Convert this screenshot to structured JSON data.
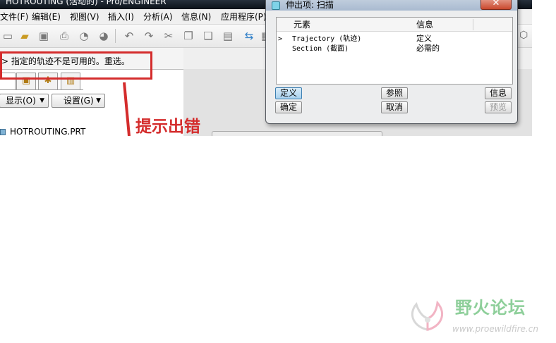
{
  "app": {
    "title": "HOTROUTING (活动的) - Pro/ENGINEER",
    "menu": [
      "文件(F)",
      "编辑(E)",
      "视图(V)",
      "插入(I)",
      "分析(A)",
      "信息(N)",
      "应用程序(P)"
    ],
    "message": "指定的轨迹不是可用的。重选。",
    "panel_dropdowns": [
      "显示(O)",
      "设置(G)"
    ],
    "tree_root": "HOTROUTING.PRT"
  },
  "dialog": {
    "title": "伸出项: 扫描",
    "columns": [
      "元素",
      "信息"
    ],
    "rows": [
      {
        "marker": ">",
        "element": "Trajectory (轨迹)",
        "info": "定义"
      },
      {
        "marker": "",
        "element": "Section (截面)",
        "info": "必需的"
      }
    ],
    "buttons": {
      "define": "定义",
      "reference": "参照",
      "info": "信息",
      "ok": "确定",
      "cancel": "取消",
      "preview": "预览"
    },
    "close_symbol": "✕"
  },
  "annotation": {
    "label": "提示出错",
    "color": "#d42c2c"
  },
  "watermark": {
    "text": "野火论坛",
    "url": "www.proewildfire.cn"
  },
  "colors": {
    "accent_red": "#d42c2c",
    "watermark_green": "#8ecf9a",
    "active_button": "#a9d2ef"
  },
  "icons": [
    "new-file-icon",
    "open-folder-icon",
    "save-icon",
    "print-icon",
    "undo-icon",
    "redo-icon",
    "cut-icon",
    "copy-icon",
    "paste-icon",
    "regenerate-icon"
  ]
}
